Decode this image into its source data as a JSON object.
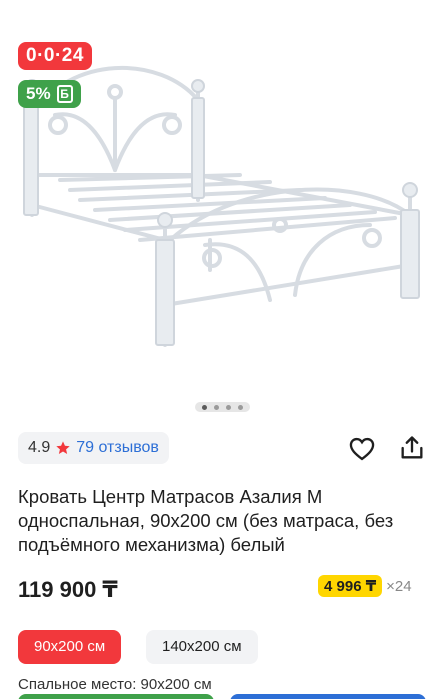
{
  "gallery": {
    "timer": "0·0·24",
    "bonus_percent": "5%",
    "bonus_icon": "Б",
    "pager_dots": 4,
    "active_dot": 1
  },
  "rating": {
    "value": "4.9",
    "reviews": "79 отзывов"
  },
  "actions": {
    "favorite_icon": "heart-icon",
    "share_icon": "share-icon"
  },
  "product": {
    "title": "Кровать Центр Матрасов Азалия М односпальная, 90х200 см (без матраса, без подъёмного механизма) белый",
    "price": "119 900 ₸",
    "installment_amount": "4 996 ₸",
    "installment_count": "×24"
  },
  "sizes": {
    "selected": "90х200 см",
    "other": "140х200 см"
  },
  "sleep_place": "Спальное место: 90х200 см",
  "colors": {
    "red": "#f2383c",
    "green": "#3fa14a",
    "yellow": "#ffd600",
    "blue": "#2d6fd6"
  }
}
